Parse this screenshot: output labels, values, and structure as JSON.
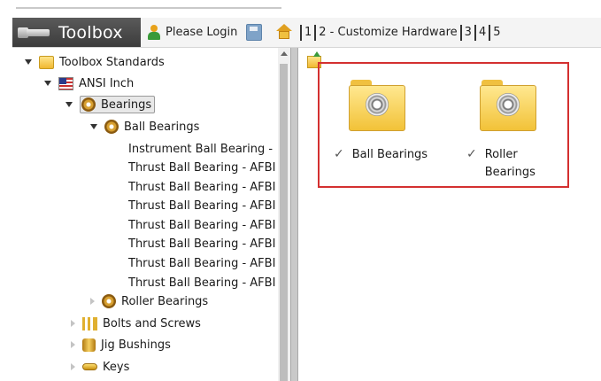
{
  "app": {
    "title": "Toolbox",
    "login_label": "Please Login"
  },
  "wizard_steps": [
    "1",
    "2 - Customize Hardware",
    "3",
    "4",
    "5"
  ],
  "tree": [
    {
      "label": "Toolbox Standards",
      "icon": "folder-icon",
      "state": "expanded",
      "level": 0
    },
    {
      "label": "ANSI Inch",
      "icon": "flag-icon",
      "state": "expanded",
      "level": 1
    },
    {
      "label": "Bearings",
      "icon": "bearing-icon",
      "state": "expanded",
      "level": 2,
      "selected": true
    },
    {
      "label": "Ball Bearings",
      "icon": "bearing-icon",
      "state": "expanded",
      "level": 3
    },
    {
      "label": "Instrument Ball Bearing -",
      "state": "leaf",
      "level": 4
    },
    {
      "label": "Thrust Ball Bearing - AFBI",
      "state": "leaf",
      "level": 4
    },
    {
      "label": "Thrust Ball Bearing - AFBI",
      "state": "leaf",
      "level": 4
    },
    {
      "label": "Thrust Ball Bearing - AFBI",
      "state": "leaf",
      "level": 4
    },
    {
      "label": "Thrust Ball Bearing - AFBI",
      "state": "leaf",
      "level": 4
    },
    {
      "label": "Thrust Ball Bearing - AFBI",
      "state": "leaf",
      "level": 4
    },
    {
      "label": "Thrust Ball Bearing - AFBI",
      "state": "leaf",
      "level": 4
    },
    {
      "label": "Thrust Ball Bearing - AFBI",
      "state": "leaf",
      "level": 4
    },
    {
      "label": "Roller Bearings",
      "icon": "bearing-icon",
      "state": "collapsed",
      "level": 3
    },
    {
      "label": "Bolts and Screws",
      "icon": "bolts-icon",
      "state": "collapsed",
      "level": 2
    },
    {
      "label": "Jig Bushings",
      "icon": "bushing-icon",
      "state": "collapsed",
      "level": 2
    },
    {
      "label": "Keys",
      "icon": "key-icon",
      "state": "collapsed",
      "level": 2
    }
  ],
  "content": {
    "folders": [
      {
        "label": "Ball Bearings",
        "checked": true,
        "icon": "bearing-folder-icon"
      },
      {
        "label": "Roller Bearings",
        "checked": true,
        "icon": "bearing-folder-icon"
      }
    ],
    "highlight_color": "#d43030"
  },
  "colors": {
    "toolbar_dark": "#4a4a4a",
    "highlight": "#d43030"
  }
}
